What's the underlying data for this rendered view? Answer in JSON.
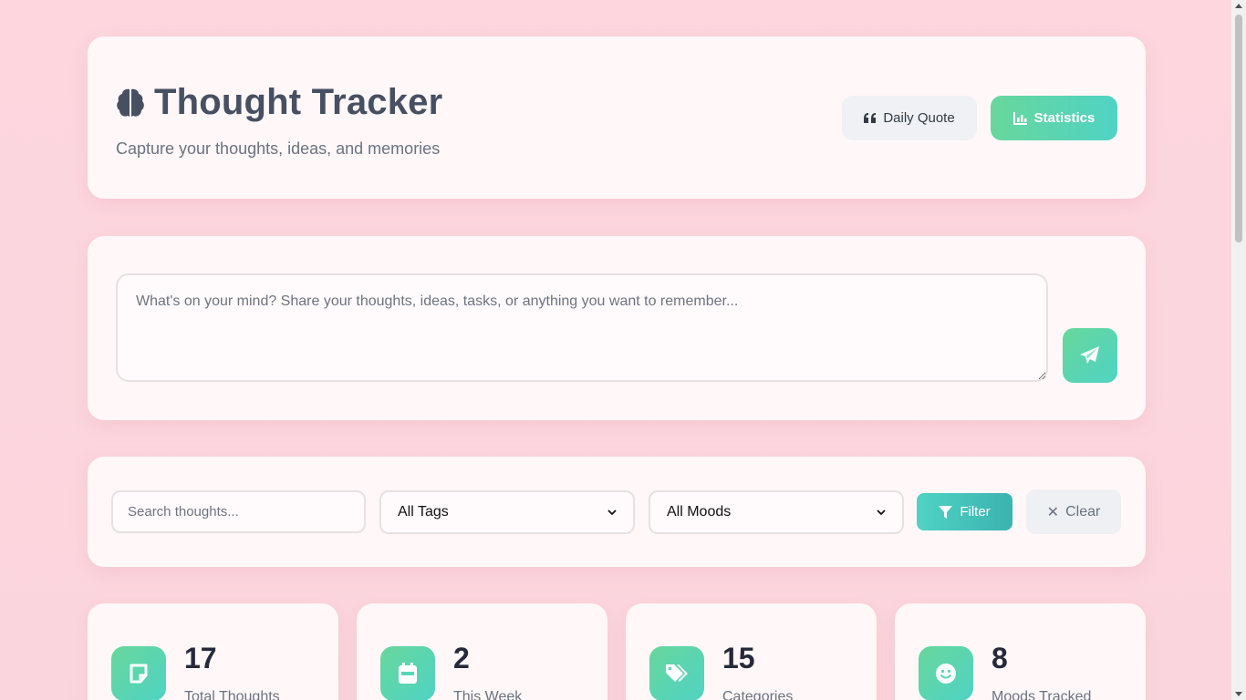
{
  "header": {
    "title": "Thought Tracker",
    "subtitle": "Capture your thoughts, ideas, and memories",
    "quote_button": "Daily Quote",
    "stats_button": "Statistics",
    "brain_icon": "brain-icon"
  },
  "compose": {
    "placeholder": "What's on your mind? Share your thoughts, ideas, tasks, or anything you want to remember...",
    "value": "",
    "send_icon": "paper-plane-icon"
  },
  "filters": {
    "search_placeholder": "Search thoughts...",
    "tags_selected": "All Tags",
    "moods_selected": "All Moods",
    "filter_button": "Filter",
    "clear_button": "Clear"
  },
  "stats": [
    {
      "value": "17",
      "label": "Total Thoughts",
      "icon": "sticky-note-icon"
    },
    {
      "value": "2",
      "label": "This Week",
      "icon": "calendar-icon"
    },
    {
      "value": "15",
      "label": "Categories",
      "icon": "tags-icon"
    },
    {
      "value": "8",
      "label": "Moods Tracked",
      "icon": "smile-icon"
    }
  ],
  "colors": {
    "background": "#fdd8df",
    "card": "#fff7f8",
    "accent_start": "#68d79c",
    "accent_end": "#4fd3c4",
    "title": "#475063"
  }
}
